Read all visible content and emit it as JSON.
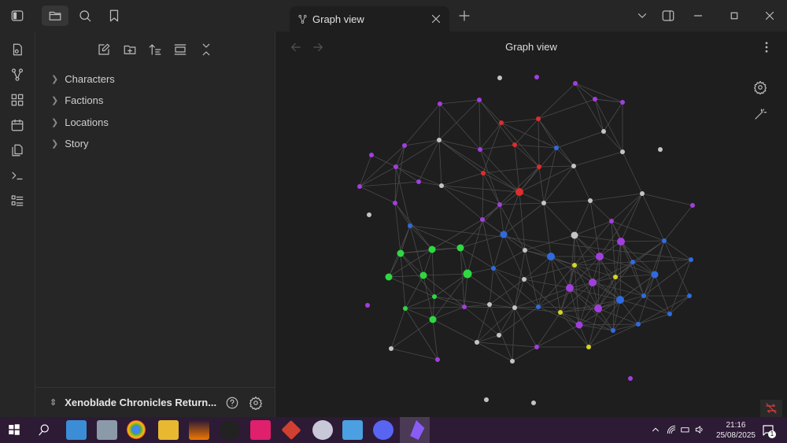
{
  "tab": {
    "title": "Graph view"
  },
  "view": {
    "title": "Graph view"
  },
  "file_tree": [
    {
      "label": "Characters"
    },
    {
      "label": "Factions"
    },
    {
      "label": "Locations"
    },
    {
      "label": "Story"
    }
  ],
  "vault": {
    "name": "Xenoblade Chronicles Return..."
  },
  "clock": {
    "time": "21:16",
    "date": "25/08/2025"
  },
  "notifications": {
    "count": "1"
  },
  "colors": {
    "gray": "#c4c4c4",
    "purple": "#a23ee0",
    "red": "#e02c2c",
    "green": "#2ed840",
    "blue": "#2f6be0",
    "yellow": "#d6d61e",
    "taskbar": "#2d1a35"
  }
}
